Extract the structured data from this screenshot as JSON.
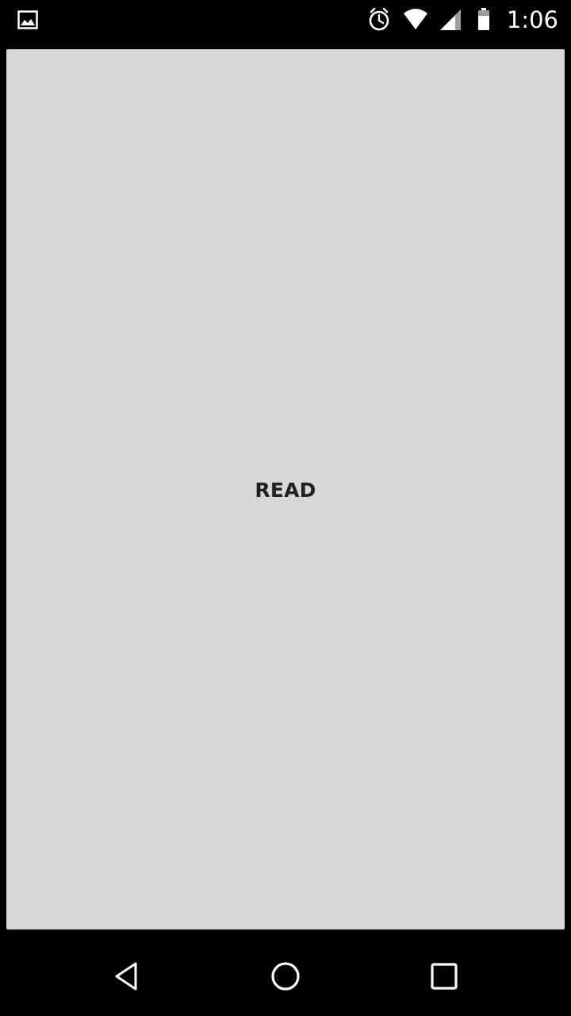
{
  "status_bar": {
    "time": "1:06",
    "icons": [
      "image-icon",
      "alarm-icon",
      "wifi-icon",
      "cell-signal-icon",
      "battery-icon"
    ]
  },
  "main": {
    "button_label": "READ",
    "panel_color": "#d6d8d8"
  },
  "nav_bar": {
    "buttons": [
      "back-icon",
      "home-icon",
      "recents-icon"
    ]
  }
}
